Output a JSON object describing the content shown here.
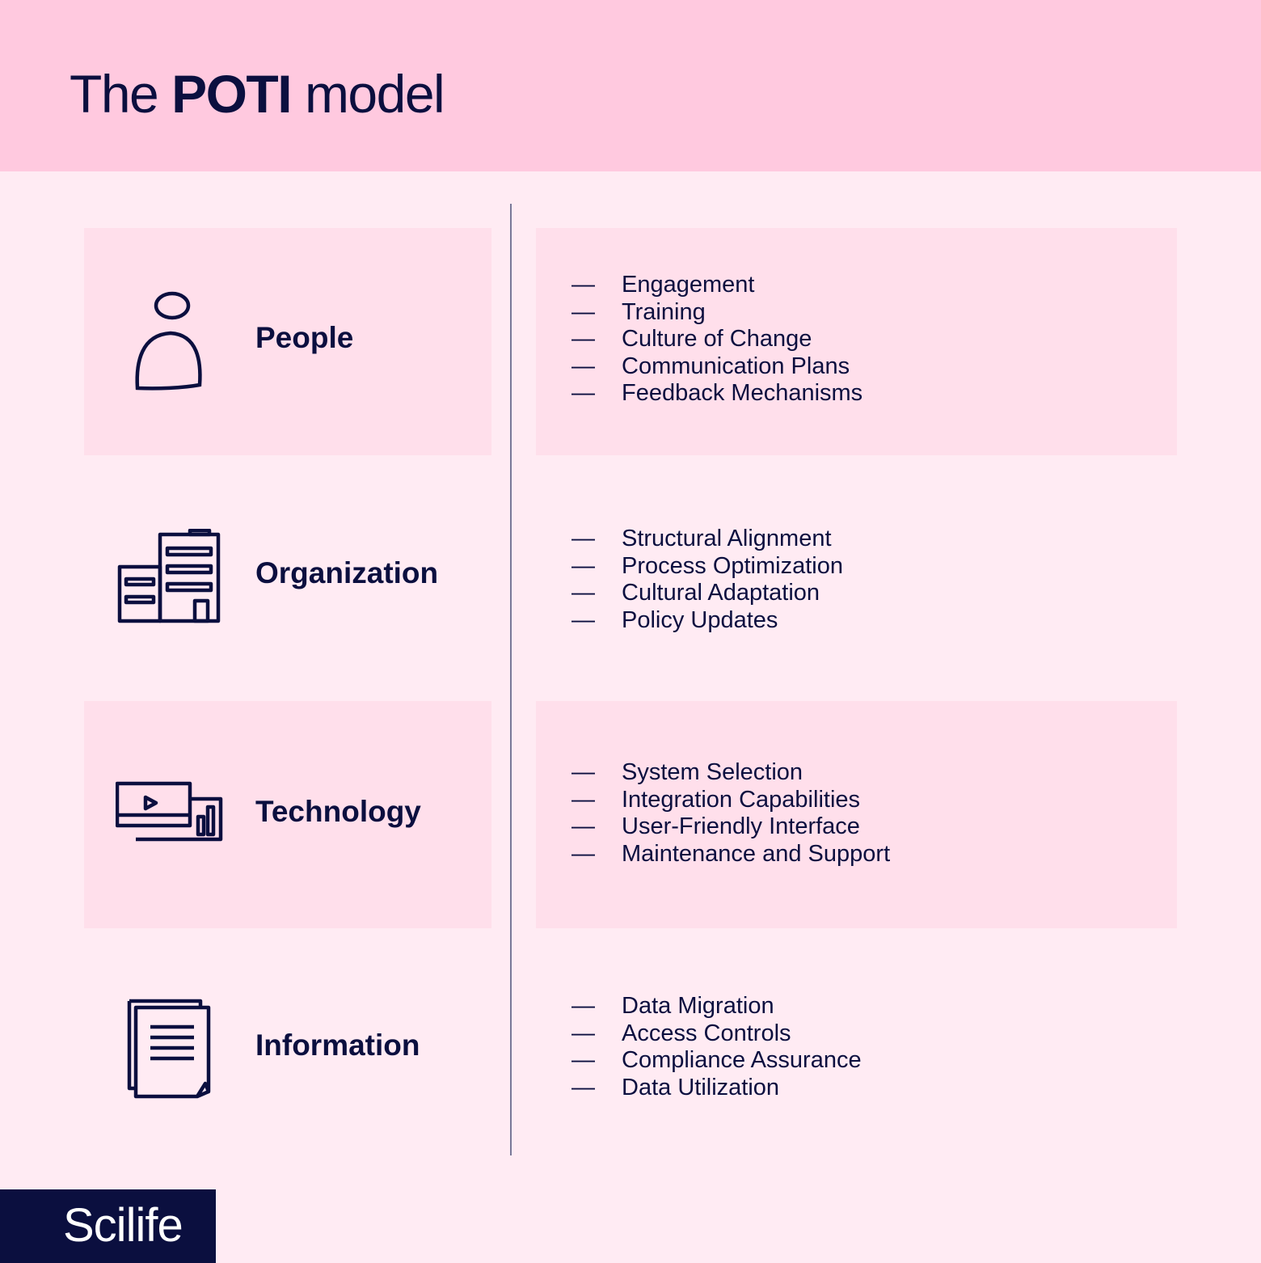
{
  "header": {
    "title_prefix": "The",
    "title_bold": "POTI",
    "title_suffix": "model"
  },
  "colors": {
    "header_bg": "#ffc9df",
    "page_bg": "#ffebf3",
    "panel_bg": "#ffdfeb",
    "text": "#0b0f3f",
    "logo_bg": "#0b0f3f"
  },
  "dash": "—",
  "categories": [
    {
      "label": "People",
      "icon": "person-icon",
      "items": [
        "Engagement",
        "Training",
        "Culture of Change",
        "Communication Plans",
        "Feedback Mechanisms"
      ]
    },
    {
      "label": "Organization",
      "icon": "building-icon",
      "items": [
        "Structural Alignment",
        "Process Optimization",
        "Cultural Adaptation",
        "Policy Updates"
      ]
    },
    {
      "label": "Technology",
      "icon": "monitor-icon",
      "items": [
        "System Selection",
        "Integration Capabilities",
        "User-Friendly Interface",
        "Maintenance and Support"
      ]
    },
    {
      "label": "Information",
      "icon": "document-icon",
      "items": [
        "Data Migration",
        "Access Controls",
        "Compliance Assurance",
        "Data Utilization"
      ]
    }
  ],
  "logo": {
    "text": "Scilife"
  }
}
